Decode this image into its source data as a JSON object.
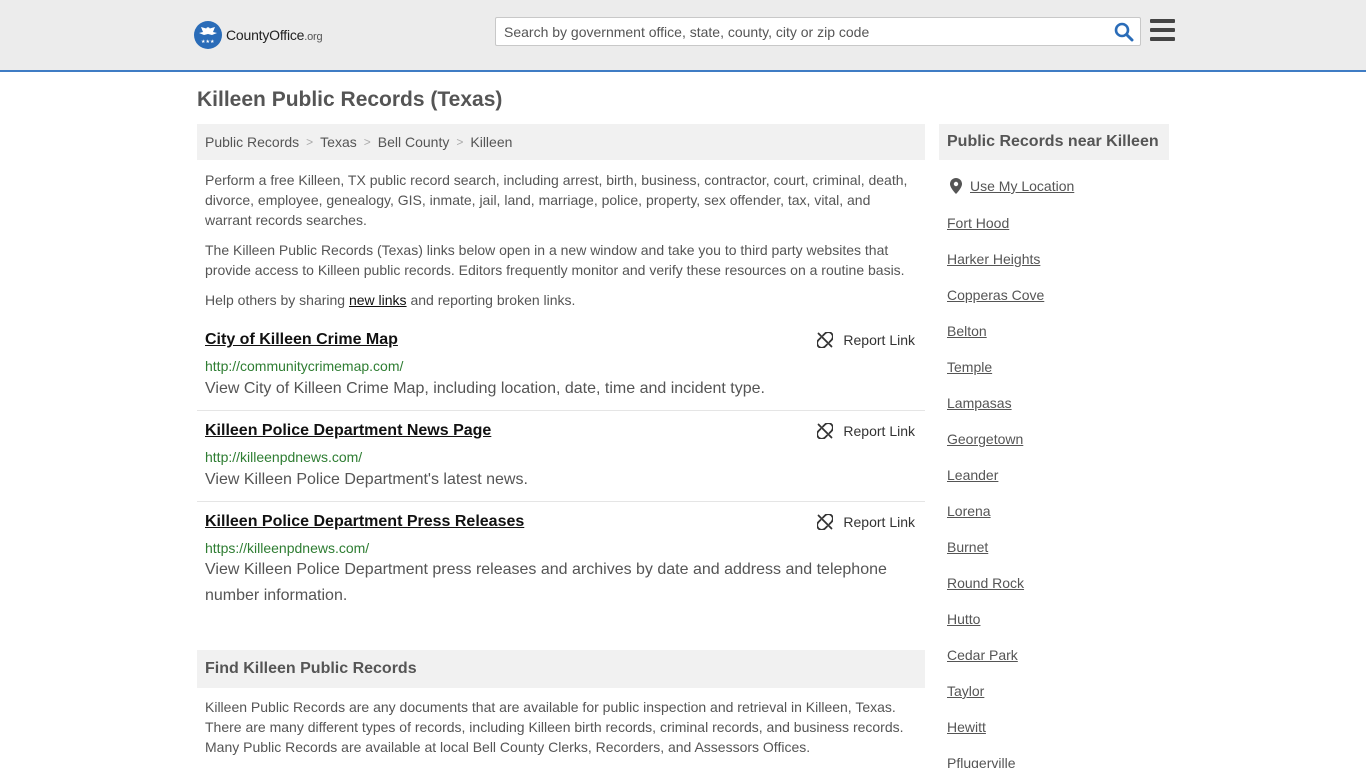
{
  "header": {
    "logo_main": "CountyOffice",
    "logo_suffix": ".org",
    "search_placeholder": "Search by government office, state, county, city or zip code"
  },
  "page": {
    "title": "Killeen Public Records (Texas)"
  },
  "breadcrumb": [
    "Public Records",
    "Texas",
    "Bell County",
    "Killeen"
  ],
  "intro": {
    "p1": "Perform a free Killeen, TX public record search, including arrest, birth, business, contractor, court, criminal, death, divorce, employee, genealogy, GIS, inmate, jail, land, marriage, police, property, sex offender, tax, vital, and warrant records searches.",
    "p2": "The Killeen Public Records (Texas) links below open in a new window and take you to third party websites that provide access to Killeen public records. Editors frequently monitor and verify these resources on a routine basis.",
    "p3_before": "Help others by sharing ",
    "p3_link": "new links",
    "p3_after": " and reporting broken links."
  },
  "records": [
    {
      "title": "City of Killeen Crime Map",
      "url": "http://communitycrimemap.com/",
      "description": "View City of Killeen Crime Map, including location, date, time and incident type.",
      "report_label": "Report Link"
    },
    {
      "title": "Killeen Police Department News Page",
      "url": "http://killeenpdnews.com/",
      "description": "View Killeen Police Department's latest news.",
      "report_label": "Report Link"
    },
    {
      "title": "Killeen Police Department Press Releases",
      "url": "https://killeenpdnews.com/",
      "description": "View Killeen Police Department press releases and archives by date and address and telephone number information.",
      "report_label": "Report Link"
    }
  ],
  "find": {
    "heading": "Find Killeen Public Records",
    "text": "Killeen Public Records are any documents that are available for public inspection and retrieval in Killeen, Texas. There are many different types of records, including Killeen birth records, criminal records, and business records. Many Public Records are available at local Bell County Clerks, Recorders, and Assessors Offices."
  },
  "sidebar": {
    "heading": "Public Records near Killeen",
    "use_location": "Use My Location",
    "places": [
      "Fort Hood",
      "Harker Heights",
      "Copperas Cove",
      "Belton",
      "Temple",
      "Lampasas",
      "Georgetown",
      "Leander",
      "Lorena",
      "Burnet",
      "Round Rock",
      "Hutto",
      "Cedar Park",
      "Taylor",
      "Hewitt",
      "Pflugerville"
    ]
  },
  "colors": {
    "brand_blue": "#2a6cb8",
    "header_border": "#3f7cc4",
    "url_green": "#2e7d32",
    "panel_gray": "#f1f1f1"
  },
  "icons": {
    "logo": "eagle-seal-icon",
    "search": "search-icon",
    "menu": "hamburger-menu-icon",
    "report": "broken-link-icon",
    "location": "map-pin-icon"
  }
}
